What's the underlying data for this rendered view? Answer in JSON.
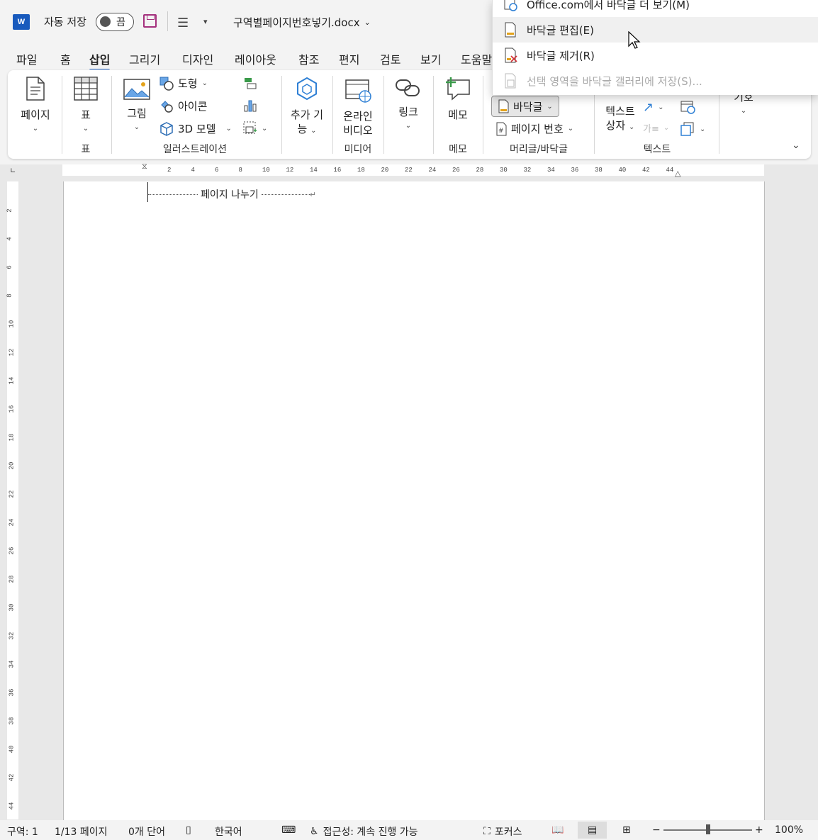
{
  "app": {
    "logo": "W",
    "autosave_label": "자동 저장",
    "autosave_state": "끔",
    "doc_title": "구역별페이지번호넣기.docx"
  },
  "tabs": [
    "파일",
    "홈",
    "삽입",
    "그리기",
    "디자인",
    "레이아웃",
    "참조",
    "편지",
    "검토",
    "보기",
    "도움말"
  ],
  "active_tab": "삽입",
  "ribbon": {
    "pages": {
      "label": "페이지"
    },
    "table": {
      "label": "표",
      "group": "표"
    },
    "illustrations": {
      "group": "일러스트레이션",
      "picture": "그림",
      "shapes": "도형",
      "icons": "아이콘",
      "models3d": "3D 모델"
    },
    "addins": {
      "label1": "추가 기",
      "label2": "능"
    },
    "media": {
      "label1": "온라인",
      "label2": "비디오",
      "group": "미디어"
    },
    "link": {
      "label": "링크"
    },
    "comments": {
      "label": "메모",
      "group": "메모"
    },
    "header_footer": {
      "footer": "바닥글",
      "page_number": "페이지 번호",
      "group": "머리글/바닥글"
    },
    "text": {
      "textbox1": "텍스트",
      "textbox2": "상자",
      "group": "텍스트"
    },
    "symbols": {
      "label": "기호"
    }
  },
  "dropdown_menu": {
    "items": [
      {
        "label": "Office.com에서 바닥글 더 보기(M)",
        "state": "normal"
      },
      {
        "label": "바닥글 편집(E)",
        "state": "hover"
      },
      {
        "label": "바닥글 제거(R)",
        "state": "normal"
      },
      {
        "label": "선택 영역을 바닥글 갤러리에 저장(S)...",
        "state": "disabled"
      }
    ]
  },
  "ruler": {
    "h_ticks": [
      "2",
      "4",
      "6",
      "8",
      "10",
      "12",
      "14",
      "16",
      "18",
      "20",
      "22",
      "24",
      "26",
      "28",
      "30",
      "32",
      "34",
      "36",
      "38",
      "40",
      "42",
      "44"
    ],
    "v_ticks": [
      "2",
      "4",
      "6",
      "8",
      "10",
      "12",
      "14",
      "16",
      "18",
      "20",
      "22",
      "24",
      "26",
      "28",
      "30",
      "32",
      "34",
      "36",
      "38",
      "40",
      "42",
      "44"
    ]
  },
  "document": {
    "page_break_label": "페이지 나누기",
    "para_mark": "↵"
  },
  "statusbar": {
    "section": "구역: 1",
    "page": "1/13 페이지",
    "words": "0개 단어",
    "language": "한국어",
    "accessibility": "접근성: 계속 진행 가능",
    "focus": "포커스",
    "zoom": "100%"
  },
  "colors": {
    "accent": "#185abd",
    "save": "#a4307d"
  }
}
